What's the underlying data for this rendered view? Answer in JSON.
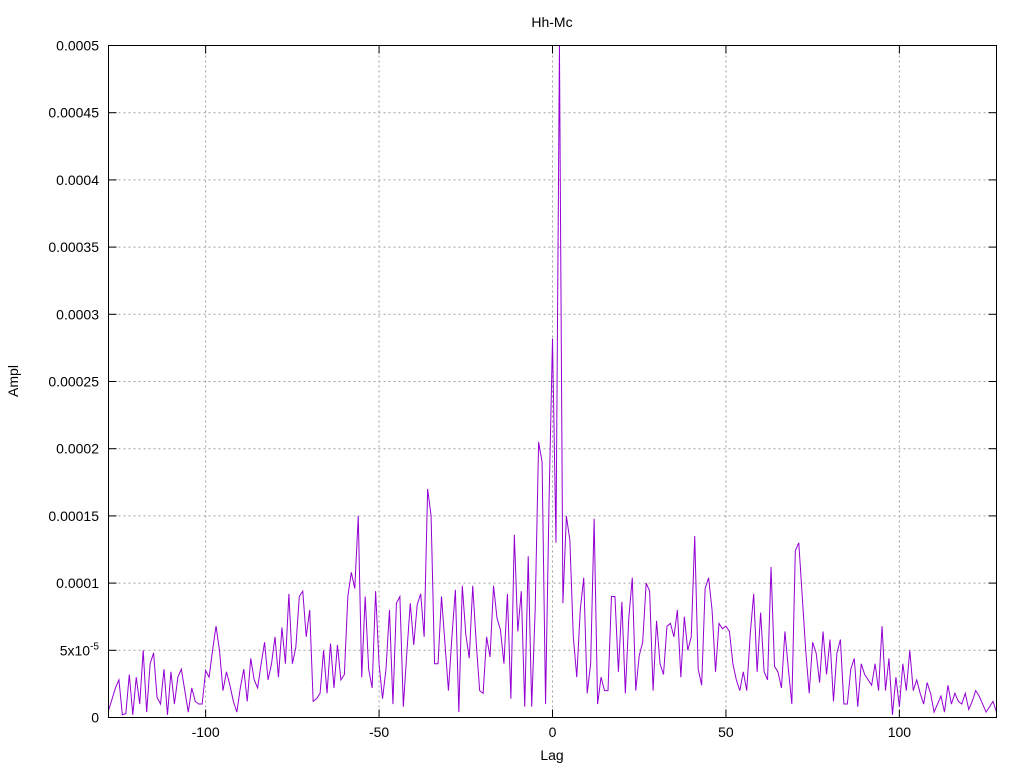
{
  "chart_data": {
    "type": "line",
    "title": "Hh-Mc",
    "xlabel": "Lag",
    "ylabel": "Ampl",
    "xlim": [
      -128,
      128
    ],
    "ylim": [
      0,
      0.0005
    ],
    "grid": true,
    "x_ticks": [
      {
        "value": -100,
        "label": "-100"
      },
      {
        "value": -50,
        "label": "-50"
      },
      {
        "value": 0,
        "label": "0"
      },
      {
        "value": 50,
        "label": "50"
      },
      {
        "value": 100,
        "label": "100"
      }
    ],
    "y_ticks": [
      {
        "value": 0,
        "label": "0"
      },
      {
        "value": 5e-05,
        "label": "5x10",
        "sup": "-5"
      },
      {
        "value": 0.0001,
        "label": "0.0001"
      },
      {
        "value": 0.00015,
        "label": "0.00015"
      },
      {
        "value": 0.0002,
        "label": "0.0002"
      },
      {
        "value": 0.00025,
        "label": "0.00025"
      },
      {
        "value": 0.0003,
        "label": "0.0003"
      },
      {
        "value": 0.00035,
        "label": "0.00035"
      },
      {
        "value": 0.0004,
        "label": "0.0004"
      },
      {
        "value": 0.00045,
        "label": "0.00045"
      },
      {
        "value": 0.0005,
        "label": "0.0005"
      }
    ],
    "series": [
      {
        "color": "#9400d3",
        "points": [
          [
            -128,
            5e-06
          ],
          [
            -126,
            2.2e-05
          ],
          [
            -125,
            2.8e-05
          ],
          [
            -124,
            2e-06
          ],
          [
            -123,
            3e-06
          ],
          [
            -122,
            3.2e-05
          ],
          [
            -121,
            2e-06
          ],
          [
            -120,
            3e-05
          ],
          [
            -119,
            1e-05
          ],
          [
            -118,
            5e-05
          ],
          [
            -117,
            4e-06
          ],
          [
            -116,
            4e-05
          ],
          [
            -115,
            4.8e-05
          ],
          [
            -114,
            1.5e-05
          ],
          [
            -113,
            1e-05
          ],
          [
            -112,
            3.6e-05
          ],
          [
            -111,
            2e-06
          ],
          [
            -110,
            3.4e-05
          ],
          [
            -109,
            1e-05
          ],
          [
            -108,
            3e-05
          ],
          [
            -107,
            3.6e-05
          ],
          [
            -106,
            2e-05
          ],
          [
            -105,
            4e-06
          ],
          [
            -104,
            2.2e-05
          ],
          [
            -103,
            1.2e-05
          ],
          [
            -102,
            1e-05
          ],
          [
            -101,
            1e-05
          ],
          [
            -100,
            3.5e-05
          ],
          [
            -99,
            3e-05
          ],
          [
            -98,
            5e-05
          ],
          [
            -97,
            6.8e-05
          ],
          [
            -96,
            5e-05
          ],
          [
            -95,
            2e-05
          ],
          [
            -94,
            3.4e-05
          ],
          [
            -93,
            2.4e-05
          ],
          [
            -92,
            1.2e-05
          ],
          [
            -91,
            4e-06
          ],
          [
            -90,
            2.2e-05
          ],
          [
            -89,
            3.6e-05
          ],
          [
            -88,
            1.2e-05
          ],
          [
            -87,
            4.4e-05
          ],
          [
            -86,
            2.8e-05
          ],
          [
            -85,
            2.2e-05
          ],
          [
            -84,
            4e-05
          ],
          [
            -83,
            5.6e-05
          ],
          [
            -82,
            2.8e-05
          ],
          [
            -81,
            4e-05
          ],
          [
            -80,
            6e-05
          ],
          [
            -79,
            3e-05
          ],
          [
            -78,
            6.7e-05
          ],
          [
            -77,
            4e-05
          ],
          [
            -76,
            9.2e-05
          ],
          [
            -75,
            4e-05
          ],
          [
            -74,
            5.2e-05
          ],
          [
            -73,
            9e-05
          ],
          [
            -72,
            9.4e-05
          ],
          [
            -71,
            6e-05
          ],
          [
            -70,
            8e-05
          ],
          [
            -69,
            1.2e-05
          ],
          [
            -68,
            1.4e-05
          ],
          [
            -67,
            1.8e-05
          ],
          [
            -66,
            5e-05
          ],
          [
            -65,
            1.8e-05
          ],
          [
            -64,
            5.5e-05
          ],
          [
            -63,
            2.2e-05
          ],
          [
            -62,
            5.4e-05
          ],
          [
            -61,
            2.8e-05
          ],
          [
            -60,
            3.2e-05
          ],
          [
            -59,
            9e-05
          ],
          [
            -58,
            0.000108
          ],
          [
            -57,
            9.6e-05
          ],
          [
            -56,
            0.00015
          ],
          [
            -55,
            3e-05
          ],
          [
            -54,
            9e-05
          ],
          [
            -53,
            3.6e-05
          ],
          [
            -52,
            2.2e-05
          ],
          [
            -51,
            9.4e-05
          ],
          [
            -50,
            4e-05
          ],
          [
            -49,
            1.4e-05
          ],
          [
            -48,
            3.6e-05
          ],
          [
            -47,
            8e-05
          ],
          [
            -46,
            1e-05
          ],
          [
            -45,
            8.5e-05
          ],
          [
            -44,
            9e-05
          ],
          [
            -43,
            8e-06
          ],
          [
            -42,
            4.8e-05
          ],
          [
            -41,
            8.5e-05
          ],
          [
            -40,
            5.4e-05
          ],
          [
            -39,
            8.4e-05
          ],
          [
            -38,
            9.2e-05
          ],
          [
            -37,
            6e-05
          ],
          [
            -36,
            0.00017
          ],
          [
            -35,
            0.00015
          ],
          [
            -34,
            4e-05
          ],
          [
            -33,
            4e-05
          ],
          [
            -32,
            9e-05
          ],
          [
            -31,
            5.5e-05
          ],
          [
            -30,
            2e-05
          ],
          [
            -29,
            6e-05
          ],
          [
            -28,
            9.5e-05
          ],
          [
            -27,
            4e-06
          ],
          [
            -26,
            9.8e-05
          ],
          [
            -25,
            6.2e-05
          ],
          [
            -24,
            4.4e-05
          ],
          [
            -23,
            9.8e-05
          ],
          [
            -22,
            5.6e-05
          ],
          [
            -21,
            2e-05
          ],
          [
            -20,
            1.8e-05
          ],
          [
            -19,
            6e-05
          ],
          [
            -18,
            4.5e-05
          ],
          [
            -17,
            9.8e-05
          ],
          [
            -16,
            7.4e-05
          ],
          [
            -15,
            6.5e-05
          ],
          [
            -14,
            4e-05
          ],
          [
            -13,
            9.2e-05
          ],
          [
            -12,
            1.4e-05
          ],
          [
            -11,
            0.000136
          ],
          [
            -10,
            6.4e-05
          ],
          [
            -9,
            9.4e-05
          ],
          [
            -8,
            8e-06
          ],
          [
            -7,
            0.00012
          ],
          [
            -6,
            8e-06
          ],
          [
            -5,
            8e-05
          ],
          [
            -4,
            0.000205
          ],
          [
            -3,
            0.00019
          ],
          [
            -2,
            1e-05
          ],
          [
            -1,
            0.00016
          ],
          [
            0,
            0.000282
          ],
          [
            1,
            0.00013
          ],
          [
            2,
            0.0005
          ],
          [
            3,
            8.5e-05
          ],
          [
            4,
            0.00015
          ],
          [
            5,
            0.000132
          ],
          [
            6,
            6e-05
          ],
          [
            7,
            3e-05
          ],
          [
            8,
            8e-05
          ],
          [
            9,
            0.000104
          ],
          [
            10,
            1.8e-05
          ],
          [
            11,
            4e-05
          ],
          [
            12,
            0.000148
          ],
          [
            13,
            1e-05
          ],
          [
            14,
            3e-05
          ],
          [
            15,
            2e-05
          ],
          [
            16,
            2e-05
          ],
          [
            17,
            9e-05
          ],
          [
            18,
            9e-05
          ],
          [
            19,
            3.4e-05
          ],
          [
            20,
            8.6e-05
          ],
          [
            21,
            1.8e-05
          ],
          [
            22,
            7.4e-05
          ],
          [
            23,
            0.000104
          ],
          [
            24,
            2e-05
          ],
          [
            25,
            4.6e-05
          ],
          [
            26,
            5.6e-05
          ],
          [
            27,
            0.0001
          ],
          [
            28,
            9.4e-05
          ],
          [
            29,
            2e-05
          ],
          [
            30,
            7.2e-05
          ],
          [
            31,
            4e-05
          ],
          [
            32,
            3.2e-05
          ],
          [
            33,
            6.8e-05
          ],
          [
            34,
            7e-05
          ],
          [
            35,
            6e-05
          ],
          [
            36,
            8e-05
          ],
          [
            37,
            3e-05
          ],
          [
            38,
            7.5e-05
          ],
          [
            39,
            5e-05
          ],
          [
            40,
            6e-05
          ],
          [
            41,
            0.000135
          ],
          [
            42,
            3.6e-05
          ],
          [
            43,
            2.4e-05
          ],
          [
            44,
            9.6e-05
          ],
          [
            45,
            0.000104
          ],
          [
            46,
            8e-05
          ],
          [
            47,
            3.4e-05
          ],
          [
            48,
            7e-05
          ],
          [
            49,
            6.6e-05
          ],
          [
            50,
            6.8e-05
          ],
          [
            51,
            6.4e-05
          ],
          [
            52,
            4e-05
          ],
          [
            53,
            2.8e-05
          ],
          [
            54,
            2e-05
          ],
          [
            55,
            3.4e-05
          ],
          [
            56,
            2e-05
          ],
          [
            57,
            6.2e-05
          ],
          [
            58,
            9.2e-05
          ],
          [
            59,
            3.4e-05
          ],
          [
            60,
            7.8e-05
          ],
          [
            61,
            3.4e-05
          ],
          [
            62,
            2.8e-05
          ],
          [
            63,
            0.000112
          ],
          [
            64,
            3.8e-05
          ],
          [
            65,
            3.4e-05
          ],
          [
            66,
            2.2e-05
          ],
          [
            67,
            6.4e-05
          ],
          [
            68,
            3.6e-05
          ],
          [
            69,
            1e-05
          ],
          [
            70,
            0.000124
          ],
          [
            71,
            0.00013
          ],
          [
            72,
            9e-05
          ],
          [
            73,
            5e-05
          ],
          [
            74,
            1.8e-05
          ],
          [
            75,
            5.6e-05
          ],
          [
            76,
            4.8e-05
          ],
          [
            77,
            2.6e-05
          ],
          [
            78,
            6.4e-05
          ],
          [
            79,
            3.2e-05
          ],
          [
            80,
            5.8e-05
          ],
          [
            81,
            1.2e-05
          ],
          [
            82,
            4.8e-05
          ],
          [
            83,
            5.8e-05
          ],
          [
            84,
            1e-05
          ],
          [
            85,
            1e-05
          ],
          [
            86,
            3.6e-05
          ],
          [
            87,
            4.4e-05
          ],
          [
            88,
            8e-06
          ],
          [
            89,
            4e-05
          ],
          [
            90,
            3.2e-05
          ],
          [
            91,
            2.8e-05
          ],
          [
            92,
            2.4e-05
          ],
          [
            93,
            4e-05
          ],
          [
            94,
            2e-05
          ],
          [
            95,
            6.8e-05
          ],
          [
            96,
            2e-05
          ],
          [
            97,
            4.4e-05
          ],
          [
            98,
            2e-06
          ],
          [
            99,
            3e-05
          ],
          [
            100,
            8e-06
          ],
          [
            101,
            4e-05
          ],
          [
            102,
            2e-05
          ],
          [
            103,
            5e-05
          ],
          [
            104,
            2e-05
          ],
          [
            105,
            2.8e-05
          ],
          [
            106,
            1.8e-05
          ],
          [
            107,
            1e-05
          ],
          [
            108,
            2.6e-05
          ],
          [
            109,
            1.8e-05
          ],
          [
            110,
            4e-06
          ],
          [
            111,
            1e-05
          ],
          [
            112,
            1.6e-05
          ],
          [
            113,
            4e-06
          ],
          [
            114,
            2.4e-05
          ],
          [
            115,
            1e-05
          ],
          [
            116,
            1.8e-05
          ],
          [
            117,
            1.2e-05
          ],
          [
            118,
            1e-05
          ],
          [
            119,
            1.8e-05
          ],
          [
            120,
            6e-06
          ],
          [
            121,
            1.2e-05
          ],
          [
            122,
            2e-05
          ],
          [
            123,
            1.6e-05
          ],
          [
            124,
            1e-05
          ],
          [
            125,
            4e-06
          ],
          [
            126,
            8e-06
          ],
          [
            127,
            1.2e-05
          ],
          [
            128,
            4e-06
          ]
        ]
      }
    ]
  }
}
